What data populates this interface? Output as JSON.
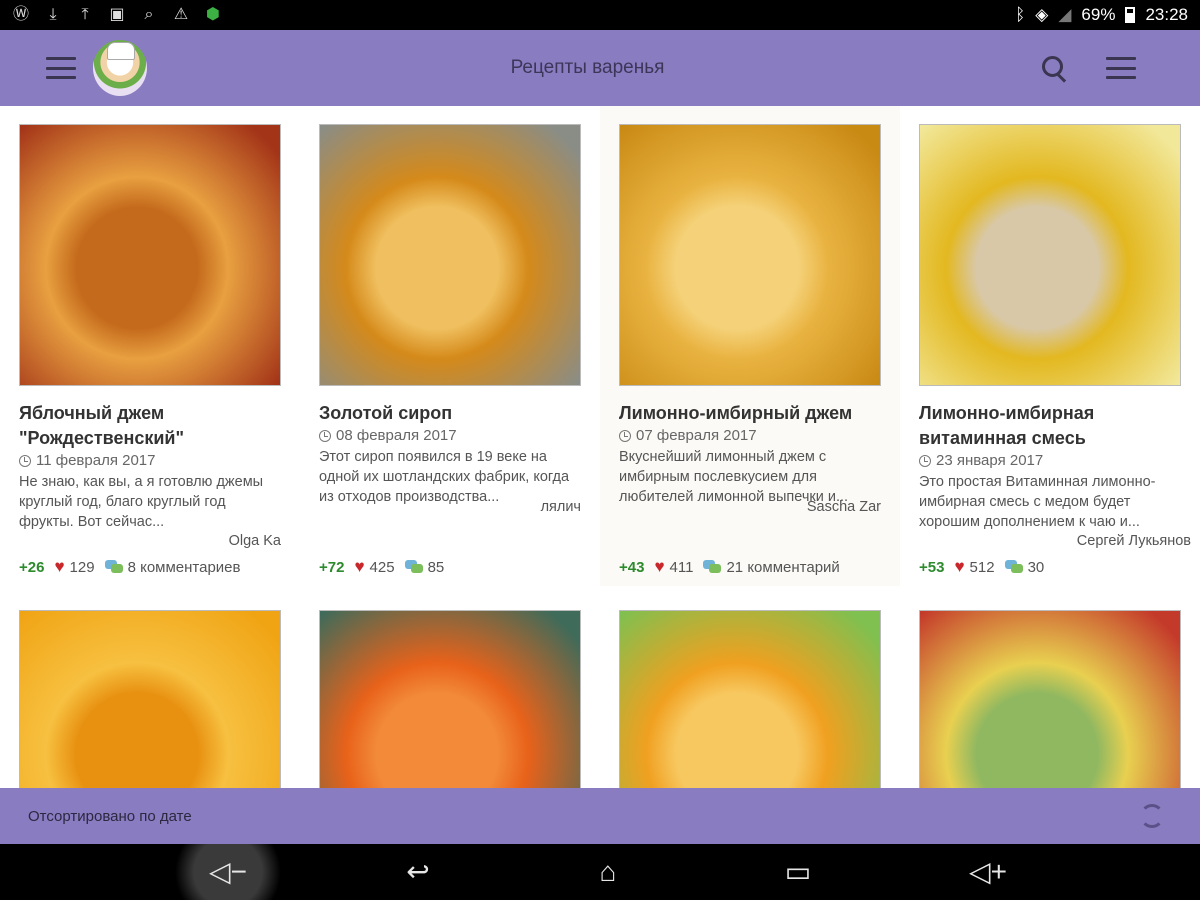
{
  "status_bar": {
    "battery": "69%",
    "time": "23:28"
  },
  "app_bar": {
    "title": "Рецепты варенья"
  },
  "cards": [
    {
      "title": "Яблочный джем \"Рождественский\"",
      "date": "11 февраля 2017",
      "desc": "Не знаю, как вы, а я готовлю джемы круглый год, благо круглый год фрукты. Вот сейчас...",
      "author": "Olga Ka",
      "score": "+26",
      "likes": "129",
      "comments": "8 комментариев",
      "image_colors": [
        "#a33418",
        "#e8a040",
        "#c46a1c"
      ]
    },
    {
      "title": "Золотой сироп",
      "date": "08 февраля 2017",
      "desc": "Этот сироп появился в 19 веке на одной их шотландских фабрик, когда из отходов производства...",
      "author": "лялич",
      "score": "+72",
      "likes": "425",
      "comments": "85",
      "image_colors": [
        "#8a8d86",
        "#d58a1a",
        "#f0c060"
      ]
    },
    {
      "title": "Лимонно-имбирный джем",
      "date": "07 февраля 2017",
      "desc": "Вкуснейший лимонный джем с имбирным послевкусием для любителей лимонной выпечки и...",
      "author": "Sascha Zar",
      "score": "+43",
      "likes": "411",
      "comments": "21 комментарий",
      "image_colors": [
        "#c98a14",
        "#e9b341",
        "#f5d27a"
      ]
    },
    {
      "title": "Лимонно-имбирная витаминная смесь",
      "date": "23 января 2017",
      "desc": "Это простая Витаминная лимонно-имбирная смесь с медом будет хорошим дополнением к чаю и...",
      "author": "Сергей Лукьянов",
      "score": "+53",
      "likes": "512",
      "comments": "30",
      "image_colors": [
        "#f2e89a",
        "#e3b820",
        "#d8c8a8"
      ]
    },
    {
      "image_colors": [
        "#f0a414",
        "#f7c040",
        "#e89010"
      ]
    },
    {
      "image_colors": [
        "#3e6b5a",
        "#e8621a",
        "#f28a3a"
      ]
    },
    {
      "image_colors": [
        "#7fc050",
        "#f0a020",
        "#f7c860"
      ]
    },
    {
      "image_colors": [
        "#c43a2a",
        "#e8d050",
        "#90b860"
      ]
    }
  ],
  "bottom_bar": {
    "sort_label": "Отсортировано по дате"
  }
}
